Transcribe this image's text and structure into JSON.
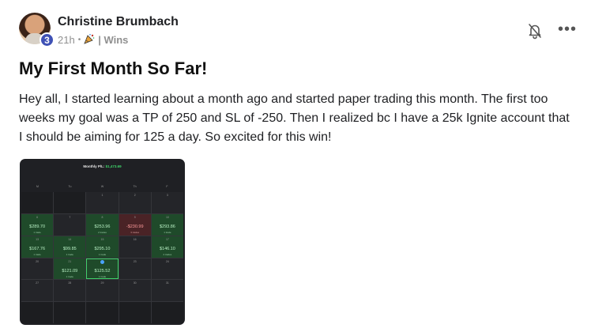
{
  "post": {
    "author": "Christine Brumbach",
    "level": "3",
    "time": "21h",
    "separator": "•",
    "category": "| Wins",
    "title": "My First Month So Far!",
    "body": "Hey all, I started learning about a month ago and started paper trading this month. The first too weeks my goal was a TP of 250 and SL of -250. Then I realized bc I have a 25k Ignite account that I should be aiming for 125 a day. So excited for this win!"
  },
  "icons": {
    "bell": "bell-off-icon",
    "more": "more-horizontal-icon",
    "category_emoji": "party-popper-icon"
  },
  "more_glyph": "•••",
  "calendar": {
    "monthly_label": "Monthly P/L:",
    "monthly_value": "$1,473.69",
    "days_of_week": [
      "M",
      "Tu",
      "W",
      "Th",
      "F"
    ],
    "cells": [
      {
        "d": "",
        "amt": "",
        "tr": "",
        "state": "dark"
      },
      {
        "d": "",
        "amt": "",
        "tr": "",
        "state": "dark"
      },
      {
        "d": "1",
        "amt": "",
        "tr": "",
        "state": ""
      },
      {
        "d": "2",
        "amt": "",
        "tr": "",
        "state": ""
      },
      {
        "d": "3",
        "amt": "",
        "tr": "",
        "state": ""
      },
      {
        "d": "6",
        "amt": "$289.70",
        "tr": "1 trade",
        "state": "win"
      },
      {
        "d": "7",
        "amt": "",
        "tr": "",
        "state": ""
      },
      {
        "d": "8",
        "amt": "$253.96",
        "tr": "2 trades",
        "state": "win"
      },
      {
        "d": "9",
        "amt": "-$230.99",
        "tr": "3 trades",
        "state": "loss"
      },
      {
        "d": "10",
        "amt": "$293.86",
        "tr": "1 trade",
        "state": "win"
      },
      {
        "d": "13",
        "amt": "$167.76",
        "tr": "1 trade",
        "state": "win"
      },
      {
        "d": "14",
        "amt": "$99.85",
        "tr": "1 trade",
        "state": "win"
      },
      {
        "d": "15",
        "amt": "$295.10",
        "tr": "1 trade",
        "state": "win"
      },
      {
        "d": "16",
        "amt": "",
        "tr": "",
        "state": ""
      },
      {
        "d": "17",
        "amt": "$146.10",
        "tr": "2 trades",
        "state": "win"
      },
      {
        "d": "20",
        "amt": "",
        "tr": "",
        "state": ""
      },
      {
        "d": "21",
        "amt": "$121.09",
        "tr": "1 trade",
        "state": "win"
      },
      {
        "d": "",
        "amt": "$125.52",
        "tr": "1 trade",
        "state": "sel"
      },
      {
        "d": "23",
        "amt": "",
        "tr": "",
        "state": ""
      },
      {
        "d": "24",
        "amt": "",
        "tr": "",
        "state": ""
      },
      {
        "d": "27",
        "amt": "",
        "tr": "",
        "state": ""
      },
      {
        "d": "28",
        "amt": "",
        "tr": "",
        "state": ""
      },
      {
        "d": "29",
        "amt": "",
        "tr": "",
        "state": ""
      },
      {
        "d": "30",
        "amt": "",
        "tr": "",
        "state": ""
      },
      {
        "d": "31",
        "amt": "",
        "tr": "",
        "state": ""
      },
      {
        "d": "",
        "amt": "",
        "tr": "",
        "state": "dark"
      },
      {
        "d": "",
        "amt": "",
        "tr": "",
        "state": "dark"
      },
      {
        "d": "",
        "amt": "",
        "tr": "",
        "state": "dark"
      },
      {
        "d": "",
        "amt": "",
        "tr": "",
        "state": "dark"
      },
      {
        "d": "",
        "amt": "",
        "tr": "",
        "state": "dark"
      }
    ]
  }
}
